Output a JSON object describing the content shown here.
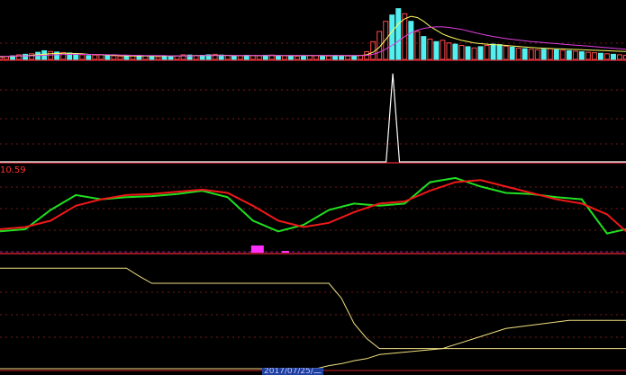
{
  "colors": {
    "background": "#000000",
    "panel_border": "#c8202a",
    "gridline": "#7a1a1a",
    "bar_up": "#ff4a4a",
    "bar_down": "#54f0f0",
    "avg_line_1": "#ffff60",
    "avg_line_2": "#e040e0",
    "spike": "#ffffff",
    "osc_fast": "#20e020",
    "osc_slow": "#f01818",
    "hist": "#ff30ff",
    "step_line": "#f0e080"
  },
  "panels": {
    "oscillator_label": "10.59",
    "date_label": "2017/07/25/二"
  },
  "chart_data": [
    {
      "type": "bar",
      "name": "volume-panel",
      "x": [
        0,
        1,
        2,
        3,
        4,
        5,
        6,
        7,
        8,
        9,
        10,
        11,
        12,
        13,
        14,
        15,
        16,
        17,
        18,
        19,
        20,
        21,
        22,
        23,
        24,
        25,
        26,
        27,
        28,
        29,
        30,
        31,
        32,
        33,
        34,
        35,
        36,
        37,
        38,
        39,
        40,
        41,
        42,
        43,
        44,
        45,
        46,
        47,
        48,
        49,
        50,
        51,
        52,
        53,
        54,
        55,
        56,
        57,
        58,
        59,
        60,
        61,
        62,
        63,
        64,
        65,
        66,
        67,
        68,
        69,
        70,
        71,
        72,
        73,
        74,
        75,
        76,
        77,
        78,
        79,
        80,
        81,
        82,
        83,
        84,
        85,
        86,
        87,
        88,
        89,
        90,
        91,
        92,
        93,
        94,
        95,
        96,
        97,
        98,
        99
      ],
      "values": [
        12,
        11,
        14,
        18,
        20,
        22,
        28,
        34,
        31,
        29,
        27,
        25,
        22,
        18,
        15,
        17,
        19,
        16,
        14,
        12,
        11,
        13,
        15,
        14,
        12,
        10,
        11,
        12,
        14,
        18,
        17,
        15,
        16,
        18,
        20,
        17,
        15,
        13,
        14,
        16,
        15,
        14,
        16,
        17,
        15,
        14,
        13,
        12,
        14,
        16,
        15,
        14,
        13,
        15,
        14,
        13,
        14,
        16,
        30,
        70,
        110,
        150,
        175,
        200,
        180,
        150,
        110,
        90,
        80,
        70,
        75,
        65,
        60,
        55,
        50,
        45,
        50,
        55,
        60,
        58,
        52,
        48,
        44,
        42,
        40,
        38,
        40,
        42,
        38,
        36,
        34,
        32,
        30,
        28,
        26,
        24,
        22,
        20,
        18,
        16
      ],
      "up": [
        true,
        true,
        false,
        true,
        false,
        true,
        false,
        false,
        true,
        false,
        true,
        false,
        false,
        true,
        false,
        true,
        true,
        false,
        true,
        true,
        false,
        true,
        false,
        true,
        false,
        true,
        false,
        false,
        true,
        true,
        false,
        true,
        false,
        false,
        true,
        false,
        true,
        false,
        true,
        false,
        true,
        true,
        false,
        true,
        false,
        true,
        false,
        true,
        false,
        true,
        true,
        false,
        true,
        false,
        false,
        true,
        false,
        true,
        true,
        true,
        true,
        true,
        false,
        false,
        true,
        false,
        true,
        false,
        true,
        false,
        true,
        true,
        false,
        true,
        false,
        true,
        false,
        true,
        false,
        false,
        true,
        false,
        true,
        false,
        true,
        true,
        false,
        true,
        false,
        true,
        false,
        true,
        false,
        true,
        true,
        false,
        true,
        false,
        true,
        true
      ],
      "series": [
        {
          "values": [
            10,
            11,
            12,
            13,
            14,
            16,
            18,
            20,
            22,
            23,
            24,
            24,
            23,
            22,
            20,
            19,
            18,
            17,
            16,
            15,
            14,
            14,
            13,
            13,
            13,
            13,
            13,
            13,
            13,
            14,
            14,
            15,
            15,
            15,
            16,
            16,
            16,
            15,
            15,
            15,
            15,
            15,
            15,
            15,
            15,
            15,
            15,
            15,
            15,
            15,
            15,
            15,
            15,
            15,
            15,
            15,
            15,
            15,
            18,
            28,
            48,
            78,
            110,
            140,
            160,
            170,
            165,
            150,
            130,
            115,
            100,
            90,
            82,
            75,
            70,
            65,
            62,
            60,
            58,
            57,
            55,
            53,
            51,
            49,
            47,
            45,
            44,
            43,
            42,
            41,
            40,
            39,
            38,
            37,
            36,
            35,
            34,
            33,
            32,
            31
          ]
        },
        {
          "values": [
            12,
            12,
            13,
            13,
            14,
            14,
            15,
            16,
            17,
            18,
            19,
            20,
            20,
            20,
            20,
            19,
            19,
            18,
            18,
            17,
            17,
            16,
            16,
            15,
            15,
            15,
            15,
            14,
            14,
            14,
            14,
            14,
            15,
            15,
            15,
            15,
            15,
            15,
            15,
            15,
            15,
            15,
            15,
            15,
            15,
            15,
            15,
            15,
            15,
            15,
            15,
            15,
            15,
            15,
            15,
            15,
            15,
            15,
            16,
            20,
            28,
            40,
            55,
            72,
            90,
            105,
            115,
            122,
            126,
            128,
            128,
            126,
            122,
            118,
            112,
            106,
            100,
            95,
            90,
            86,
            82,
            79,
            76,
            73,
            70,
            68,
            66,
            64,
            62,
            60,
            58,
            56,
            54,
            52,
            50,
            48,
            46,
            44,
            42,
            40
          ]
        }
      ],
      "ylim": [
        0,
        220
      ]
    },
    {
      "type": "line",
      "name": "spike-panel",
      "x": [
        0,
        50,
        51,
        52,
        53,
        54,
        99
      ],
      "values": [
        0,
        0,
        0,
        100,
        0,
        0,
        0
      ],
      "ylim": [
        0,
        110
      ]
    },
    {
      "type": "line",
      "name": "oscillator-panel",
      "x": [
        0,
        4,
        8,
        12,
        16,
        20,
        24,
        28,
        32,
        36,
        40,
        44,
        48,
        52,
        56,
        60,
        64,
        68,
        72,
        76,
        80,
        84,
        88,
        92,
        96,
        99
      ],
      "series": [
        {
          "values": [
            20,
            22,
            40,
            54,
            50,
            52,
            53,
            55,
            58,
            52,
            30,
            20,
            26,
            40,
            46,
            44,
            46,
            66,
            70,
            62,
            56,
            55,
            52,
            50,
            18,
            22
          ]
        },
        {
          "values": [
            22,
            24,
            30,
            44,
            50,
            54,
            55,
            57,
            59,
            56,
            44,
            30,
            24,
            28,
            38,
            46,
            48,
            58,
            66,
            68,
            62,
            56,
            50,
            46,
            36,
            20
          ]
        }
      ],
      "hist": [
        0,
        0,
        0,
        0,
        0,
        0,
        0,
        0,
        0,
        0,
        8,
        2,
        0,
        0,
        0,
        0,
        0,
        0,
        0,
        0,
        0,
        0,
        0,
        0,
        0,
        0
      ],
      "ylim": [
        0,
        80
      ]
    },
    {
      "type": "line",
      "name": "step-panel",
      "x": [
        0,
        10,
        20,
        22,
        24,
        30,
        40,
        50,
        52,
        54,
        56,
        58,
        60,
        70,
        75,
        80,
        90,
        99
      ],
      "series": [
        {
          "values": [
            100,
            100,
            100,
            92,
            85,
            85,
            85,
            85,
            85,
            70,
            45,
            30,
            20,
            20,
            20,
            20,
            20,
            20
          ]
        },
        {
          "values": [
            0,
            0,
            0,
            0,
            0,
            0,
            0,
            0,
            3,
            5,
            8,
            10,
            14,
            20,
            30,
            40,
            48,
            48
          ]
        }
      ],
      "ylim": [
        0,
        110
      ]
    }
  ]
}
